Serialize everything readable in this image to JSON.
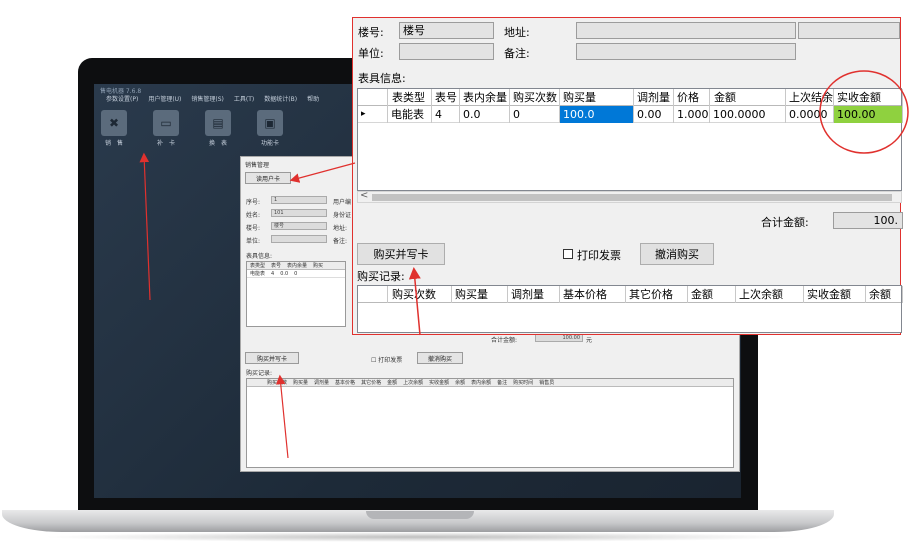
{
  "laptop_screen": {
    "app_title": "售电机器 7.6.8",
    "menu": [
      "参数设置(P)",
      "用户管理(U)",
      "销售管理(S)",
      "工具(T)",
      "数据统计(B)",
      "帮助"
    ],
    "toolbar": [
      {
        "label": "销　售",
        "icon": "tools-icon"
      },
      {
        "label": "补　卡",
        "icon": "card-icon"
      },
      {
        "label": "换　表",
        "icon": "meter-icon"
      },
      {
        "label": "功能卡",
        "icon": "wallet-icon"
      }
    ],
    "window_title": "销售管理",
    "read_card_label": "读用户卡",
    "fields": [
      {
        "label": "序号:",
        "value": "1"
      },
      {
        "label": "姓名:",
        "value": "101"
      },
      {
        "label": "楼号:",
        "value": "楼号"
      },
      {
        "label": "单位:",
        "value": ""
      }
    ],
    "right_fields": [
      "用户编",
      "身份证",
      "地址:",
      "备注:"
    ],
    "meter_info_label": "表具信息:",
    "grid_headers": [
      "表类型",
      "表号",
      "表内余量",
      "购买"
    ],
    "grid_row": [
      "电能表",
      "4",
      "0.0",
      "0"
    ],
    "total_label": "合计金额:",
    "total_value": "100.00",
    "total_unit": "元",
    "buy_label": "购买并写卡",
    "print_label": "打印发票",
    "cancel_label": "撤消购买",
    "records_label": "购买记录:",
    "records_headers": [
      "购买次数",
      "购买量",
      "调剂量",
      "基本价格",
      "其它价格",
      "金额",
      "上次余额",
      "实收金额",
      "余额",
      "表内余额",
      "备注",
      "购买时间",
      "销售员"
    ]
  },
  "zoom_panel": {
    "building_label": "楼号:",
    "building_value": "楼号",
    "address_label": "地址:",
    "unit_label": "单位:",
    "remark_label": "备注:",
    "meter_info_label": "表具信息:",
    "grid_headers": [
      "表类型",
      "表号",
      "表内余量",
      "购买次数",
      "购买量",
      "调剂量",
      "价格",
      "金额",
      "上次结余",
      "实收金额"
    ],
    "grid_row": [
      "电能表",
      "4",
      "0.0",
      "0",
      "100.0",
      "0.00",
      "1.0000",
      "100.0000",
      "0.0000",
      "100.00"
    ],
    "row_marker": "▸",
    "scroll_left": "<",
    "total_label": "合计金额:",
    "total_value": "100.",
    "buy_label": "购买并写卡",
    "print_label": "打印发票",
    "cancel_label": "撤消购买",
    "records_label": "购买记录:",
    "records_headers": [
      "购买次数",
      "购买量",
      "调剂量",
      "基本价格",
      "其它价格",
      "金额",
      "上次余额",
      "实收金额",
      "余额"
    ]
  },
  "colors": {
    "accent_red": "#e0312e",
    "selected_blue": "#0078d7",
    "highlight_green": "#8fd13f"
  }
}
